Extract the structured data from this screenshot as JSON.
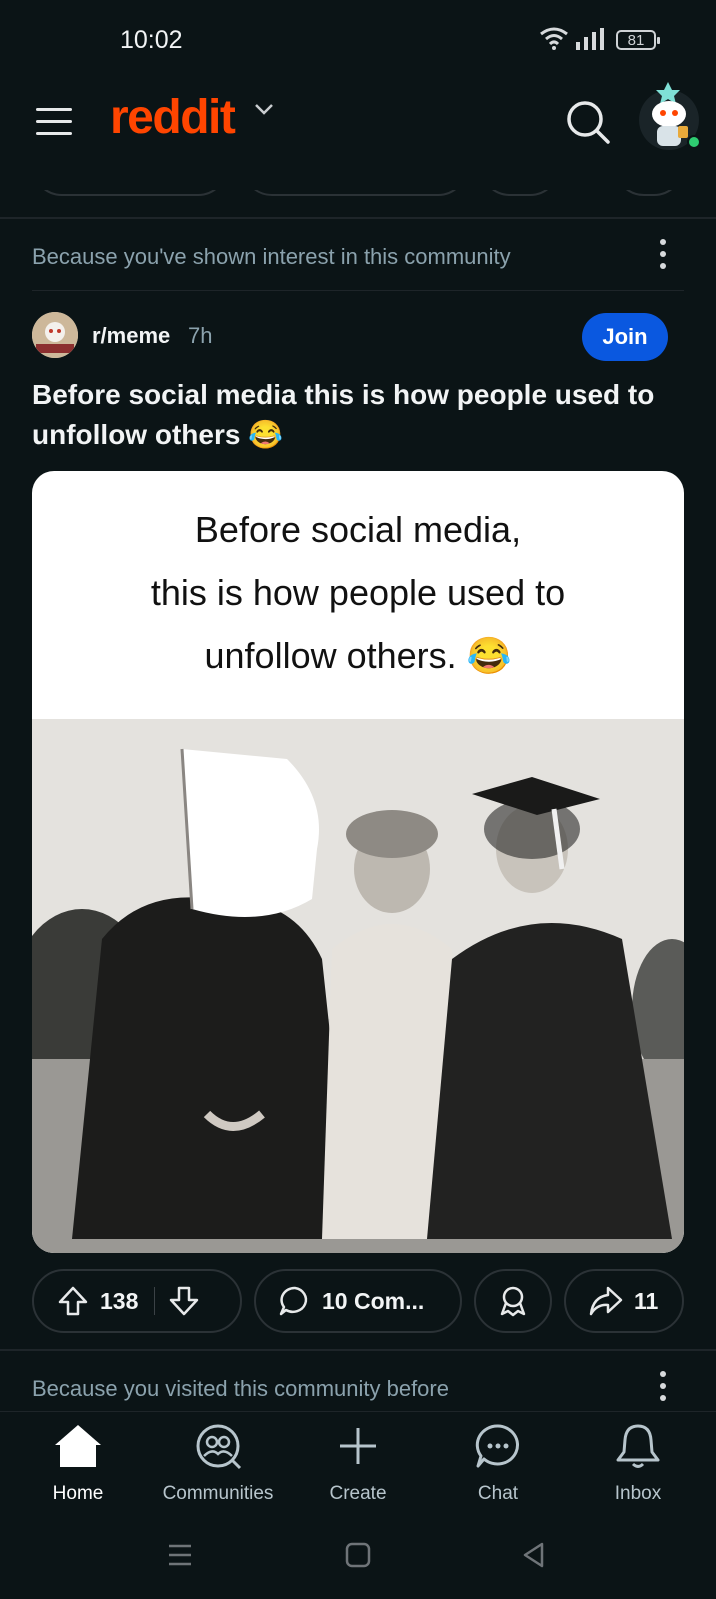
{
  "status_bar": {
    "time": "10:02",
    "battery": "81"
  },
  "header": {
    "logo_text": "reddit"
  },
  "feed": {
    "section1_reason": "Because you've shown interest in this community",
    "post": {
      "subreddit": "r/meme",
      "age": "7h",
      "join_label": "Join",
      "title": "Before social media this is how people used to unfollow others 😂",
      "image_caption_lines": [
        "Before social media,",
        "this is how people used to",
        "unfollow others. 😂"
      ],
      "upvotes": "138",
      "comments_label": "10 Com...",
      "shares": "11"
    },
    "section2_reason": "Because you visited this community before"
  },
  "bottom_nav": {
    "items": [
      {
        "label": "Home",
        "icon": "home-icon"
      },
      {
        "label": "Communities",
        "icon": "communities-icon"
      },
      {
        "label": "Create",
        "icon": "plus-icon"
      },
      {
        "label": "Chat",
        "icon": "chat-icon"
      },
      {
        "label": "Inbox",
        "icon": "bell-icon"
      }
    ]
  },
  "colors": {
    "background": "#0b1416",
    "brand": "#ff4500",
    "join": "#0a58e0",
    "muted_text": "#8ba2ad"
  }
}
